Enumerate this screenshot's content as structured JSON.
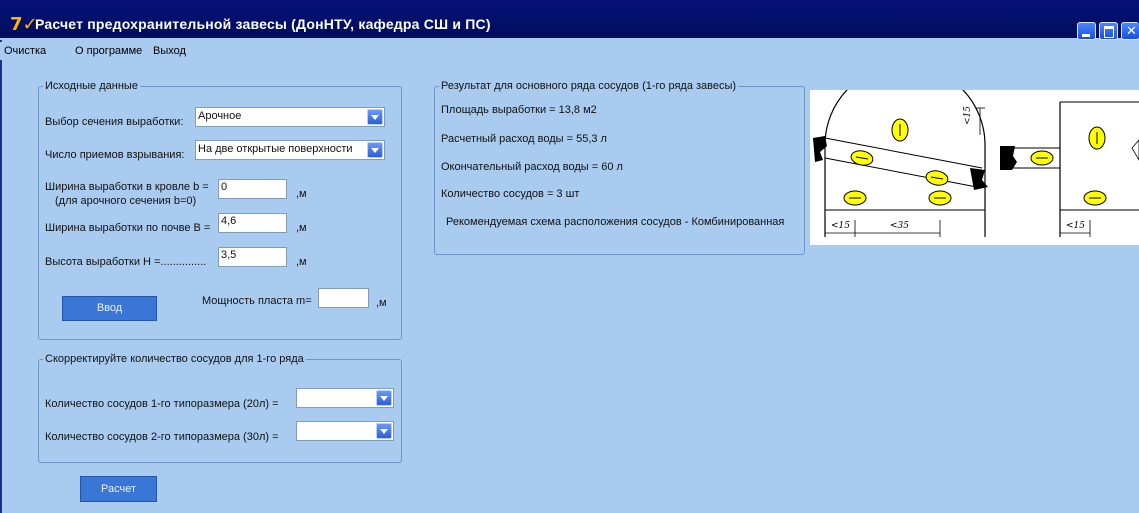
{
  "window": {
    "title": "Расчет предохранительной завесы (ДонНТУ, кафедра СШ и ПС)"
  },
  "menu": [
    "Очистка",
    "О программе",
    "Выход"
  ],
  "input_group": {
    "legend": "Исходные данные",
    "section_label": "Выбор сечения выработки:",
    "section_value": "Арочное",
    "blast_label": "Число приемов взрывания:",
    "blast_value": "На две открытые поверхности",
    "roof_width_label": "Ширина выработки в кровле b =",
    "roof_width_note": "(для арочного сечения b=0)",
    "roof_width_value": "0",
    "floor_width_label": "Ширина выработки по почве B =",
    "floor_width_value": "4,6",
    "height_label": "Высота выработки H =...............",
    "height_value": "3,5",
    "unit": ",м",
    "enter_button": "Ввод",
    "seam_label": "Мощность пласта m=",
    "seam_value": "",
    "seam_unit": ",м"
  },
  "correct_group": {
    "legend": "Скорректируйте количество сосудов для 1-го ряда",
    "type1_label": "Количество сосудов 1-го типоразмера (20л) =",
    "type1_value": "",
    "type2_label": "Количество сосудов 2-го типоразмера (30л) =",
    "type2_value": ""
  },
  "calc_button": "Расчет",
  "results": {
    "legend": "Результат для основного ряда сосудов (1-го ряда завесы)",
    "area": "Площадь выработки = 13,8 м2",
    "water_calc": "Расчетный расход воды = 55,3 л",
    "water_final": "Окончательный расход воды = 60 л",
    "vessels": "Количество сосудов = 3 шт",
    "scheme": "Рекомендуемая схема расположения сосудов - Комбинированная"
  },
  "scheme_image": {
    "dim_left": "<15",
    "dim_middle": "<35",
    "dim_top": "<15",
    "dim_right": "<15"
  },
  "colors": {
    "background": "#a9cbef",
    "titlebar": "#021068",
    "vessel_fill": "#ffff00"
  }
}
